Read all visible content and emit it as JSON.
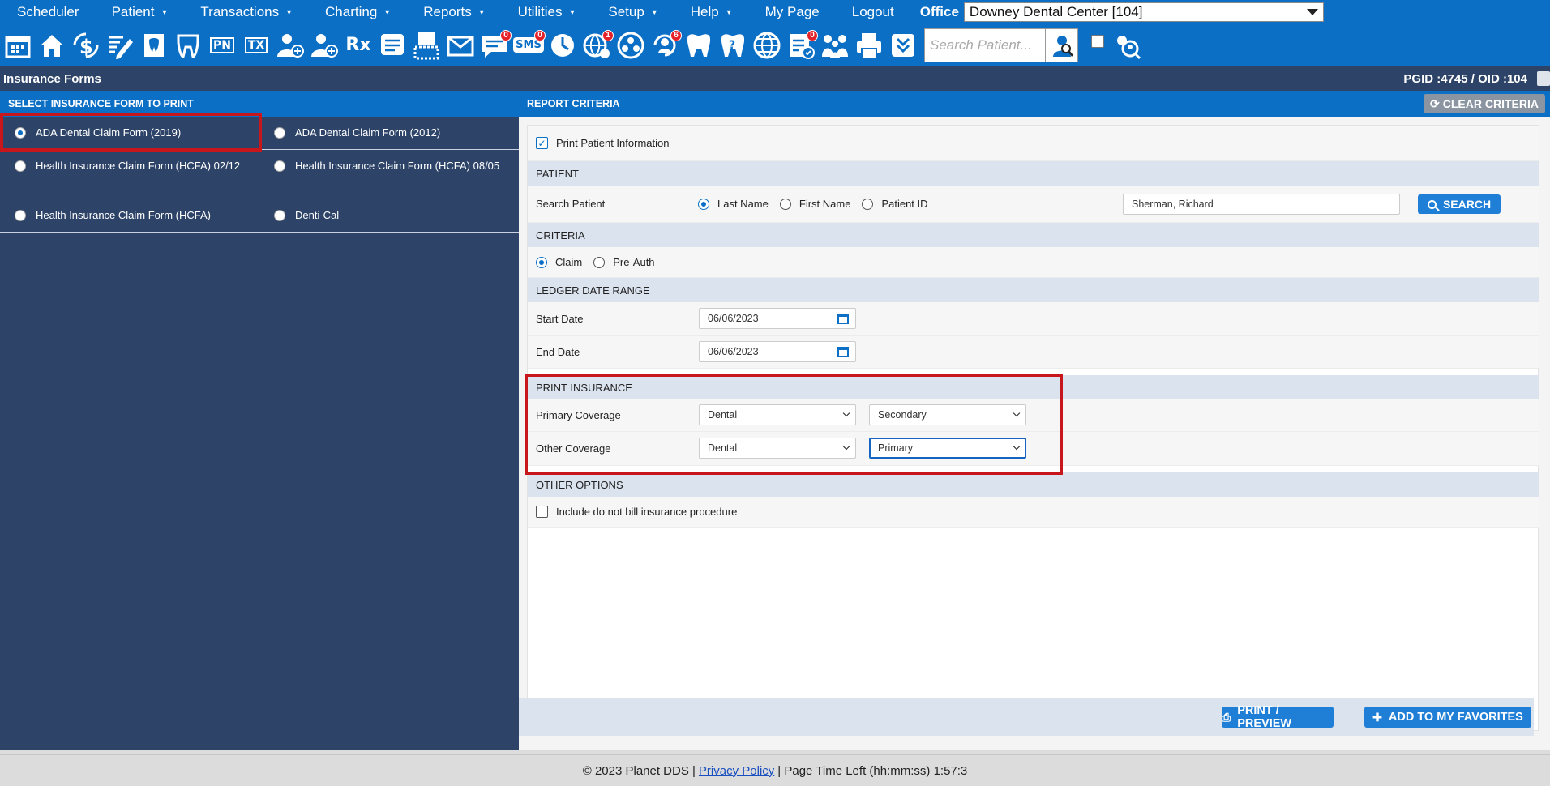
{
  "nav": {
    "items": [
      {
        "label": "Scheduler",
        "caret": false
      },
      {
        "label": "Patient",
        "caret": true
      },
      {
        "label": "Transactions",
        "caret": true
      },
      {
        "label": "Charting",
        "caret": true
      },
      {
        "label": "Reports",
        "caret": true
      },
      {
        "label": "Utilities",
        "caret": true
      },
      {
        "label": "Setup",
        "caret": true
      },
      {
        "label": "Help",
        "caret": true
      },
      {
        "label": "My Page",
        "caret": false
      },
      {
        "label": "Logout",
        "caret": false
      }
    ],
    "office_label": "Office",
    "office_value": "Downey Dental Center [104]"
  },
  "toolbar": {
    "icons": [
      {
        "name": "calendar-icon"
      },
      {
        "name": "home-icon"
      },
      {
        "name": "dollar-sync-icon"
      },
      {
        "name": "pencil-note-icon"
      },
      {
        "name": "tooth-doc-icon"
      },
      {
        "name": "tooth-icon"
      },
      {
        "name": "pn-icon",
        "text": "PN"
      },
      {
        "name": "tx-icon",
        "text": "TX"
      },
      {
        "name": "add-patient-icon"
      },
      {
        "name": "add-user-icon"
      },
      {
        "name": "rx-icon",
        "text": "Rx"
      },
      {
        "name": "notes-icon"
      },
      {
        "name": "scanner-icon"
      },
      {
        "name": "mail-icon"
      },
      {
        "name": "chat-icon",
        "badge": "0"
      },
      {
        "name": "sms-icon",
        "text": "SMS",
        "badge": "0"
      },
      {
        "name": "clock-icon"
      },
      {
        "name": "globe-user-icon",
        "badge": "1"
      },
      {
        "name": "network-icon"
      },
      {
        "name": "refresh-user-icon",
        "badge": "6"
      },
      {
        "name": "tooth-white-icon"
      },
      {
        "name": "question-tooth-icon"
      },
      {
        "name": "web-icon"
      },
      {
        "name": "checklist-icon",
        "badge": "0"
      },
      {
        "name": "family-icon"
      },
      {
        "name": "printer-icon"
      },
      {
        "name": "download-icon"
      }
    ],
    "search_placeholder": "Search Patient..."
  },
  "page": {
    "title": "Insurance Forms",
    "ids": "PGID :4745  /  OID :104"
  },
  "left": {
    "header": "SELECT INSURANCE FORM TO PRINT",
    "forms": [
      {
        "label": "ADA Dental Claim Form (2019)",
        "selected": true
      },
      {
        "label": "ADA Dental Claim Form (2012)",
        "selected": false
      },
      {
        "label": "Health Insurance Claim Form (HCFA) 02/12",
        "selected": false
      },
      {
        "label": "Health Insurance Claim Form (HCFA) 08/05",
        "selected": false
      },
      {
        "label": "Health Insurance Claim Form (HCFA)",
        "selected": false
      },
      {
        "label": "Denti-Cal",
        "selected": false
      }
    ]
  },
  "right": {
    "header": "REPORT CRITERIA",
    "clear_label": "CLEAR CRITERIA",
    "print_patient_info": "Print Patient Information",
    "sections": {
      "patient": "PATIENT",
      "criteria": "CRITERIA",
      "ledger": "LEDGER DATE RANGE",
      "print_insurance": "PRINT INSURANCE",
      "other_options": "OTHER OPTIONS"
    },
    "search_patient_label": "Search Patient",
    "search_by": [
      "Last Name",
      "First Name",
      "Patient ID"
    ],
    "search_value": "Sherman, Richard",
    "search_button": "SEARCH",
    "criteria_options": [
      "Claim",
      "Pre-Auth"
    ],
    "start_date_label": "Start Date",
    "start_date": "06/06/2023",
    "end_date_label": "End Date",
    "end_date": "06/06/2023",
    "primary_coverage_label": "Primary Coverage",
    "primary_coverage_type": "Dental",
    "primary_coverage_order": "Secondary",
    "other_coverage_label": "Other Coverage",
    "other_coverage_type": "Dental",
    "other_coverage_order": "Primary",
    "include_dnb_label": "Include do not bill insurance procedure",
    "print_preview_label": "PRINT / PREVIEW",
    "favorites_label": "ADD TO MY FAVORITES"
  },
  "footer": {
    "copyright": "© 2023 Planet DDS |",
    "privacy": "Privacy Policy",
    "time_left": "|  Page Time Left (hh:mm:ss) 1:57:3"
  },
  "colors": {
    "nav_blue": "#0b6fc6",
    "dark_panel": "#2d4468",
    "highlight_red": "#c8161d"
  }
}
